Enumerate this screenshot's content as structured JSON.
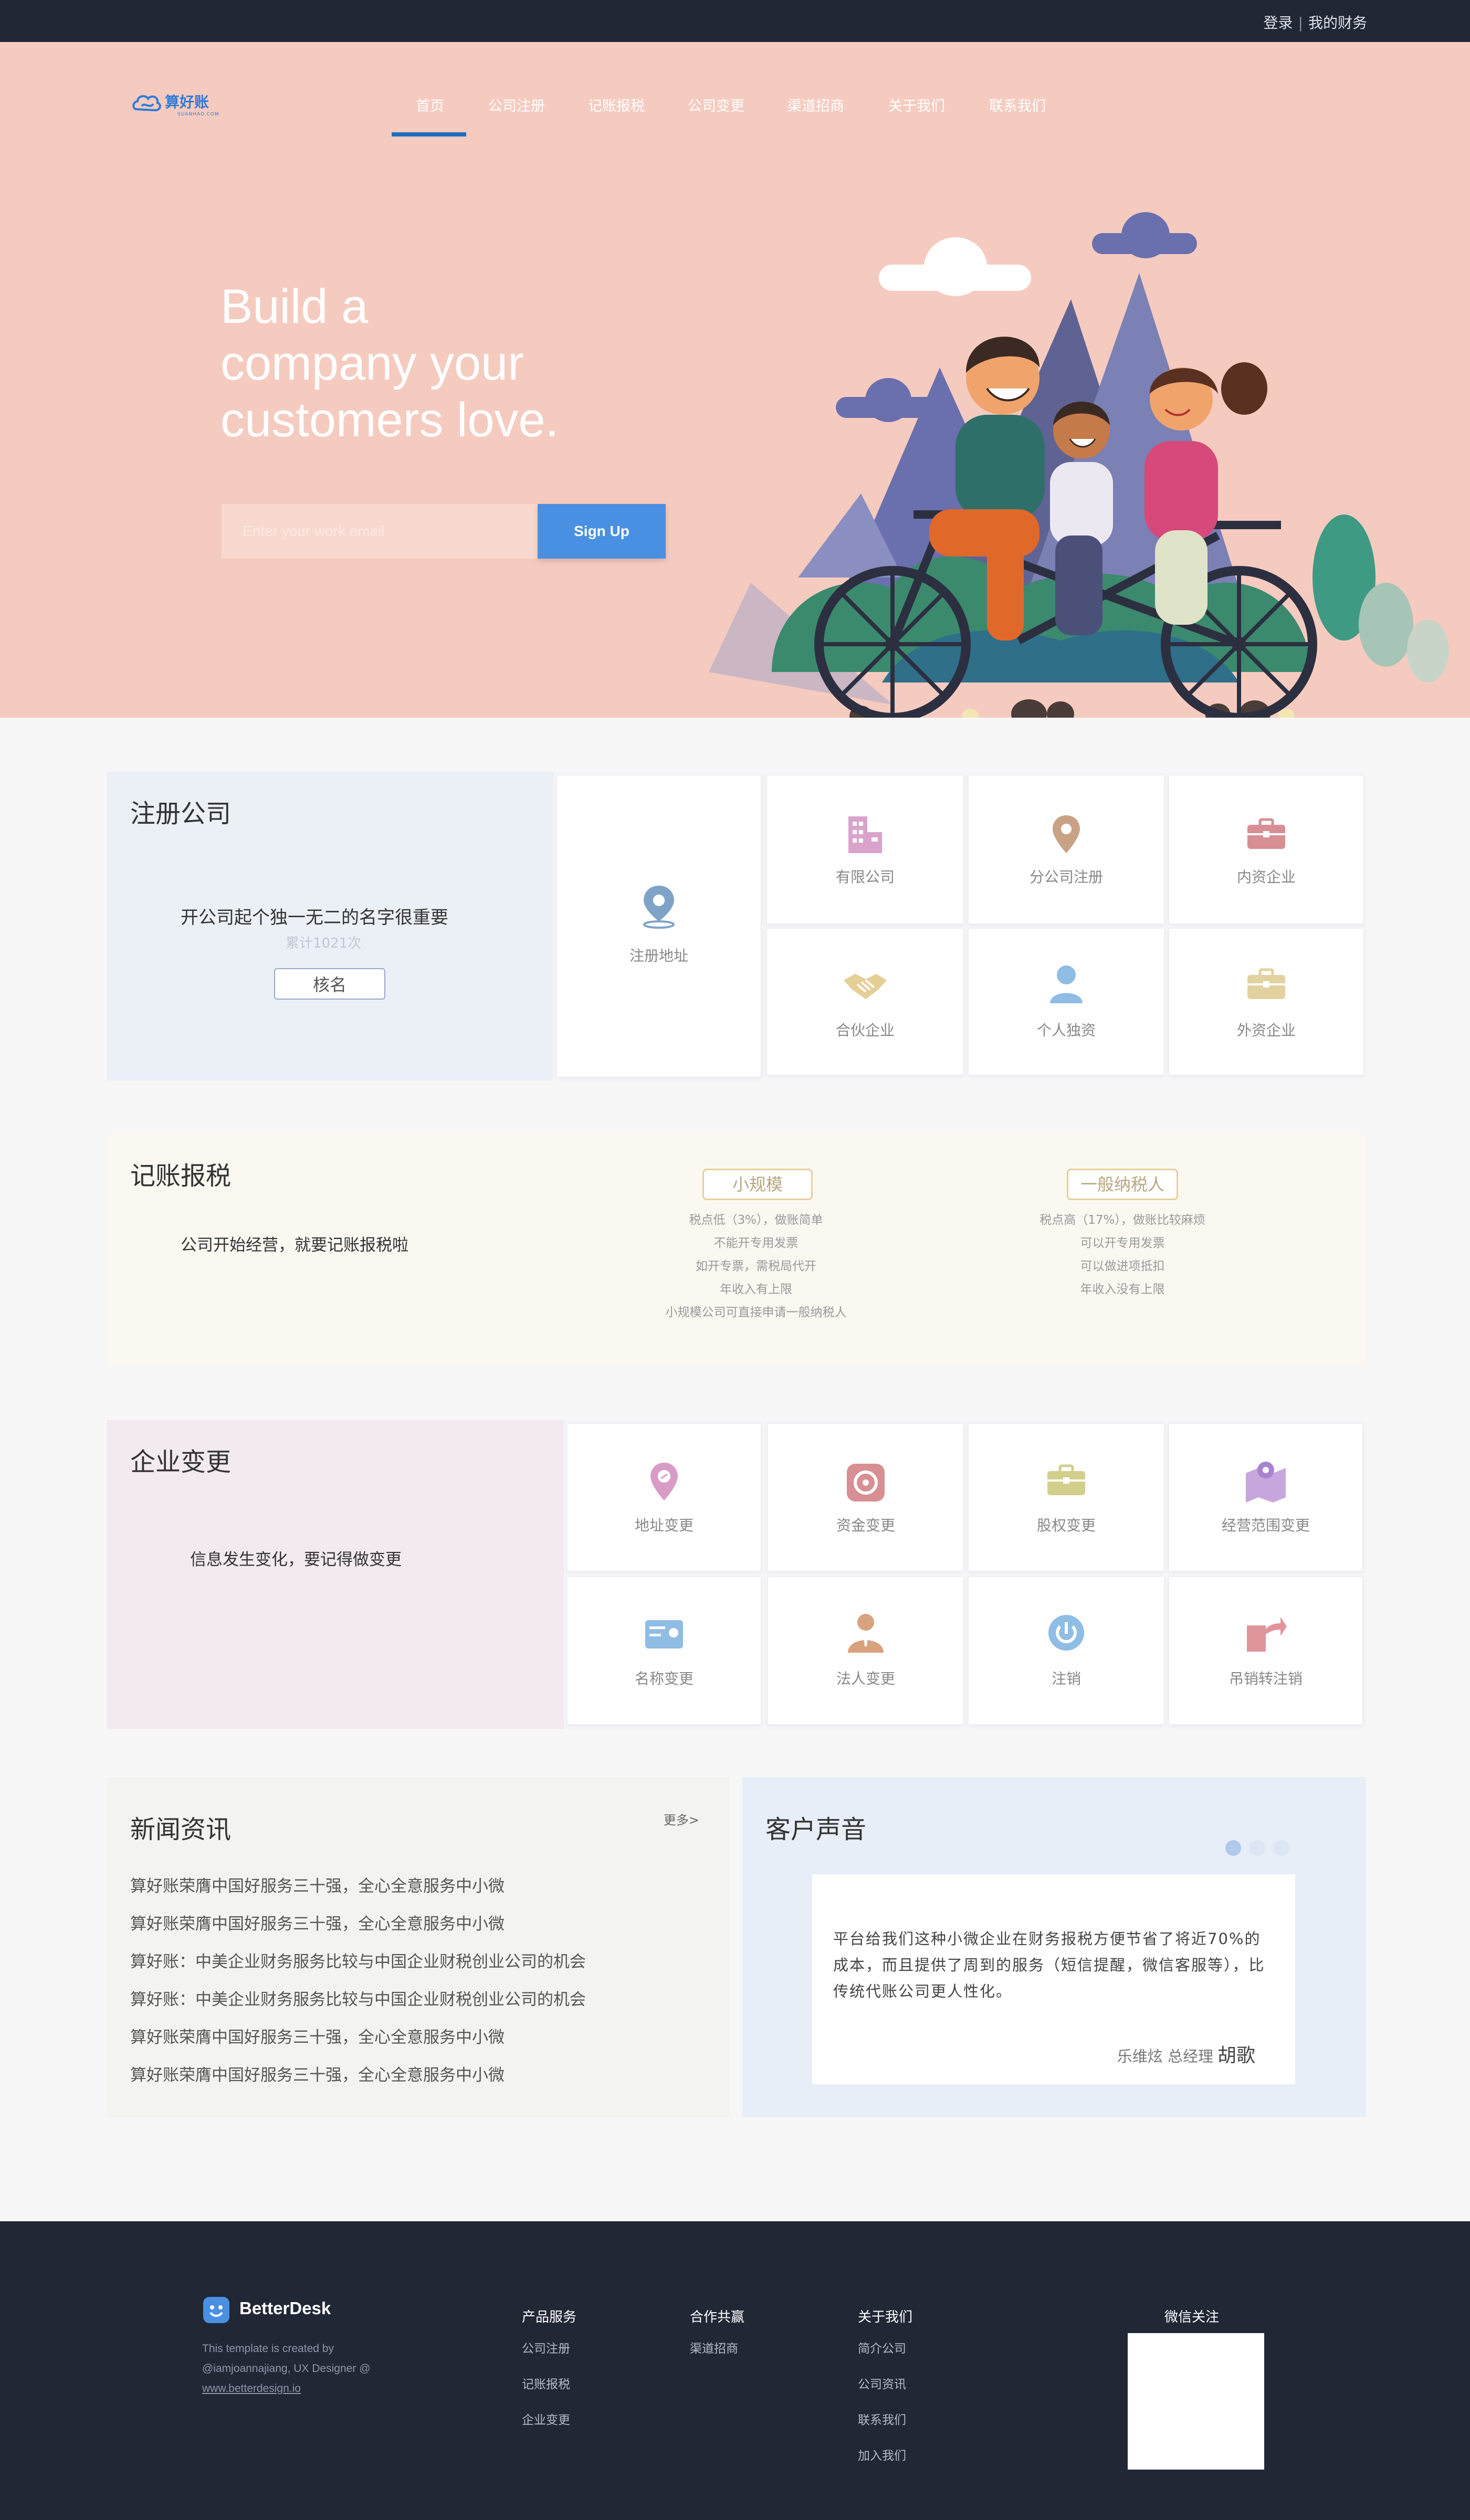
{
  "topbar": {
    "login": "登录",
    "separator": "|",
    "my_finance": "我的财务"
  },
  "nav": {
    "items": [
      "首页",
      "公司注册",
      "记账报税",
      "公司变更",
      "渠道招商",
      "关于我们",
      "联系我们"
    ],
    "active_index": 0
  },
  "logo": {
    "name": "算好账",
    "sub": "SUANHAO.COM"
  },
  "hero": {
    "headline": [
      "Build a",
      "company your",
      "customers love."
    ],
    "email_placeholder": "Enter your work email",
    "signup_label": "Sign Up"
  },
  "register": {
    "title": "注册公司",
    "slogan": "开公司起个独一无二的名字很重要",
    "count": "累计1021次",
    "name_button": "核名",
    "tiles": [
      {
        "label": "注册地址",
        "icon": "map-pin-icon"
      },
      {
        "label": "有限公司",
        "icon": "building-icon"
      },
      {
        "label": "分公司注册",
        "icon": "location-icon"
      },
      {
        "label": "内资企业",
        "icon": "briefcase-icon"
      },
      {
        "label": "合伙企业",
        "icon": "handshake-icon"
      },
      {
        "label": "个人独资",
        "icon": "person-icon"
      },
      {
        "label": "外资企业",
        "icon": "briefcase-icon"
      }
    ]
  },
  "tax": {
    "title": "记账报税",
    "slogan": "公司开始经营，就要记账报税啦",
    "small": {
      "label": "小规模",
      "lines": [
        "税点低（3%），做账简单",
        "不能开专用发票",
        "如开专票，需税局代开",
        "年收入有上限",
        "小规模公司可直接申请一般纳税人"
      ]
    },
    "general": {
      "label": "一般纳税人",
      "lines": [
        "税点高（17%），做账比较麻烦",
        "可以开专用发票",
        "可以做进项抵扣",
        "年收入没有上限"
      ]
    }
  },
  "change": {
    "title": "企业变更",
    "slogan": "信息发生变化，要记得做变更",
    "tiles": [
      {
        "label": "地址变更",
        "icon": "address-pin-icon"
      },
      {
        "label": "资金变更",
        "icon": "capital-icon"
      },
      {
        "label": "股权变更",
        "icon": "equity-briefcase-icon"
      },
      {
        "label": "经营范围变更",
        "icon": "business-scope-map-icon"
      },
      {
        "label": "名称变更",
        "icon": "id-card-icon"
      },
      {
        "label": "法人变更",
        "icon": "legal-person-icon"
      },
      {
        "label": "注销",
        "icon": "power-icon"
      },
      {
        "label": "吊销转注销",
        "icon": "transfer-arrow-icon"
      }
    ]
  },
  "news": {
    "title": "新闻资讯",
    "more": "更多>",
    "items": [
      "算好账荣膺中国好服务三十强，全心全意服务中小微",
      "算好账荣膺中国好服务三十强，全心全意服务中小微",
      "算好账：中美企业财务服务比较与中国企业财税创业公司的机会",
      "算好账：中美企业财务服务比较与中国企业财税创业公司的机会",
      "算好账荣膺中国好服务三十强，全心全意服务中小微",
      "算好账荣膺中国好服务三十强，全心全意服务中小微"
    ]
  },
  "voice": {
    "title": "客户声音",
    "quote": "平台给我们这种小微企业在财务报税方便节省了将近70%的成本，而且提供了周到的服务（短信提醒，微信客服等），比传统代账公司更人性化。",
    "author_title": "乐维炫 总经理",
    "author_name": "胡歌",
    "active_dot": 0,
    "dot_count": 3
  },
  "footer": {
    "brand": "BetterDesk",
    "desc_line1": "This template is created by",
    "desc_line2": "@iamjoannajiang, UX Designer @",
    "desc_link": "www.betterdesign.io",
    "cols": [
      {
        "title": "产品服务",
        "items": [
          "公司注册",
          "记账报税",
          "企业变更"
        ]
      },
      {
        "title": "合作共赢",
        "items": [
          "渠道招商"
        ]
      },
      {
        "title": "关于我们",
        "items": [
          "简介公司",
          "公司资讯",
          "联系我们",
          "加入我们"
        ]
      }
    ],
    "wechat": "微信关注"
  },
  "colors": {
    "topbar": "#222736",
    "hero_bg": "#f5cbc0",
    "accent_blue": "#4a90e2",
    "nav_underline": "#1f6dbd",
    "register_bg": "#ebf0f7",
    "tax_bg": "#fbf8f2",
    "change_bg": "#f2e9f1",
    "news_bg": "#f3f4ef",
    "voice_bg": "#e8eef8"
  }
}
